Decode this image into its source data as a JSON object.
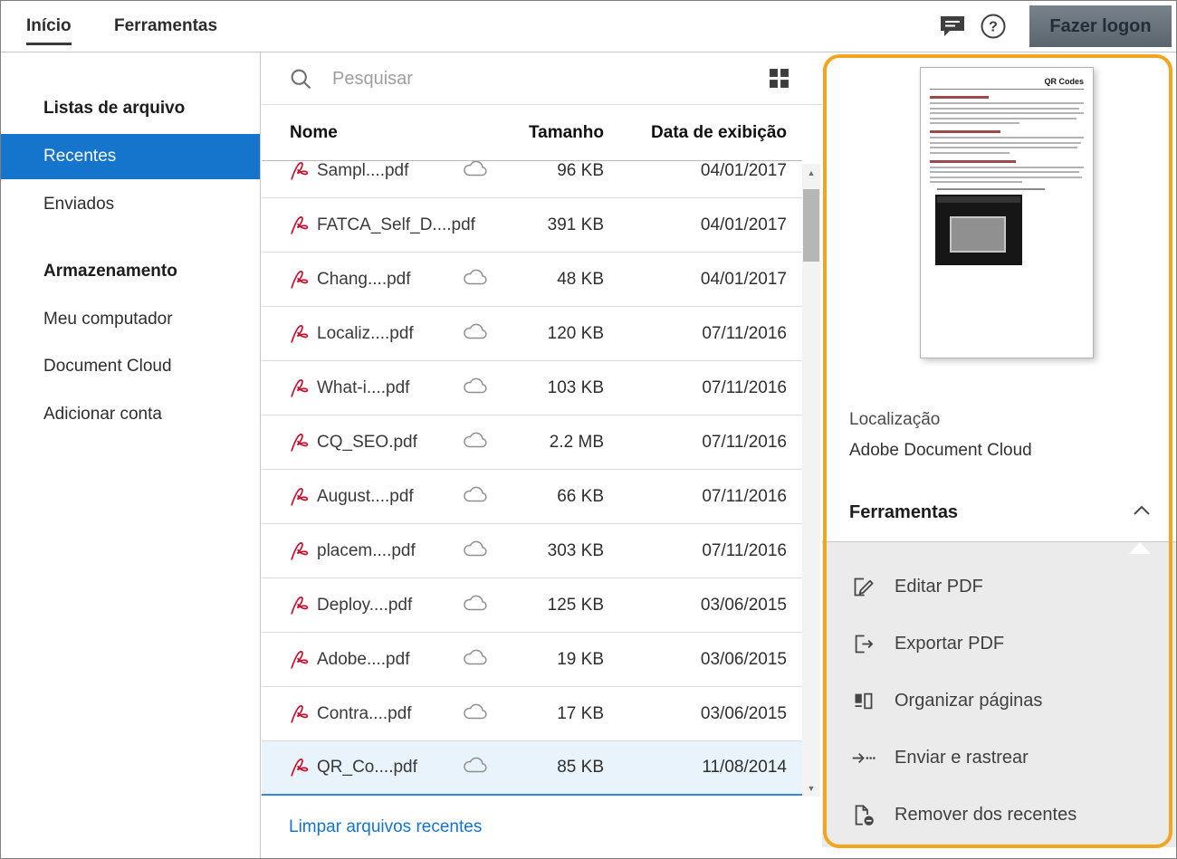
{
  "topbar": {
    "tabs": [
      {
        "label": "Início",
        "active": true
      },
      {
        "label": "Ferramentas",
        "active": false
      }
    ],
    "signin_label": "Fazer logon"
  },
  "sidebar": {
    "sections": [
      {
        "header": "Listas de arquivo",
        "items": [
          {
            "label": "Recentes",
            "selected": true
          },
          {
            "label": "Enviados",
            "selected": false
          }
        ]
      },
      {
        "header": "Armazenamento",
        "items": [
          {
            "label": "Meu computador",
            "selected": false
          },
          {
            "label": "Document Cloud",
            "selected": false
          },
          {
            "label": "Adicionar conta",
            "selected": false
          }
        ]
      }
    ]
  },
  "filelist": {
    "search_placeholder": "Pesquisar",
    "columns": [
      "Nome",
      "Tamanho",
      "Data de exibição"
    ],
    "rows": [
      {
        "name": "Sampl....pdf",
        "size": "96 KB",
        "date": "04/01/2017",
        "cloud": true,
        "clipped": true,
        "selected": false
      },
      {
        "name": "FATCA_Self_D....pdf",
        "size": "391 KB",
        "date": "04/01/2017",
        "cloud": false,
        "clipped": false,
        "selected": false
      },
      {
        "name": "Chang....pdf",
        "size": "48 KB",
        "date": "04/01/2017",
        "cloud": true,
        "clipped": false,
        "selected": false
      },
      {
        "name": "Localiz....pdf",
        "size": "120 KB",
        "date": "07/11/2016",
        "cloud": true,
        "clipped": false,
        "selected": false
      },
      {
        "name": "What-i....pdf",
        "size": "103 KB",
        "date": "07/11/2016",
        "cloud": true,
        "clipped": false,
        "selected": false
      },
      {
        "name": "CQ_SEO.pdf",
        "size": "2.2 MB",
        "date": "07/11/2016",
        "cloud": true,
        "clipped": false,
        "selected": false
      },
      {
        "name": "August....pdf",
        "size": "66 KB",
        "date": "07/11/2016",
        "cloud": true,
        "clipped": false,
        "selected": false
      },
      {
        "name": "placem....pdf",
        "size": "303 KB",
        "date": "07/11/2016",
        "cloud": true,
        "clipped": false,
        "selected": false
      },
      {
        "name": "Deploy....pdf",
        "size": "125 KB",
        "date": "03/06/2015",
        "cloud": true,
        "clipped": false,
        "selected": false
      },
      {
        "name": "Adobe....pdf",
        "size": "19 KB",
        "date": "03/06/2015",
        "cloud": true,
        "clipped": false,
        "selected": false
      },
      {
        "name": "Contra....pdf",
        "size": "17 KB",
        "date": "03/06/2015",
        "cloud": true,
        "clipped": false,
        "selected": false
      },
      {
        "name": "QR_Co....pdf",
        "size": "85 KB",
        "date": "11/08/2014",
        "cloud": true,
        "clipped": false,
        "selected": true
      }
    ],
    "clear_link": "Limpar arquivos recentes"
  },
  "preview": {
    "doc_title": "QR Codes",
    "location_label": "Localização",
    "location_value": "Adobe Document Cloud",
    "tools_header": "Ferramentas",
    "tools": [
      {
        "label": "Editar PDF",
        "icon": "edit-pdf-icon"
      },
      {
        "label": "Exportar PDF",
        "icon": "export-pdf-icon"
      },
      {
        "label": "Organizar páginas",
        "icon": "organize-pages-icon"
      },
      {
        "label": "Enviar e rastrear",
        "icon": "send-track-icon"
      },
      {
        "label": "Remover dos recentes",
        "icon": "remove-recent-icon"
      }
    ]
  },
  "colors": {
    "accent_blue": "#1575cc",
    "link_blue": "#1374d2",
    "selected_row_bg": "#e9f3fb",
    "selected_row_border": "#3488d8",
    "highlight_orange": "#f3a51d",
    "pdf_red": "#c8102e"
  }
}
